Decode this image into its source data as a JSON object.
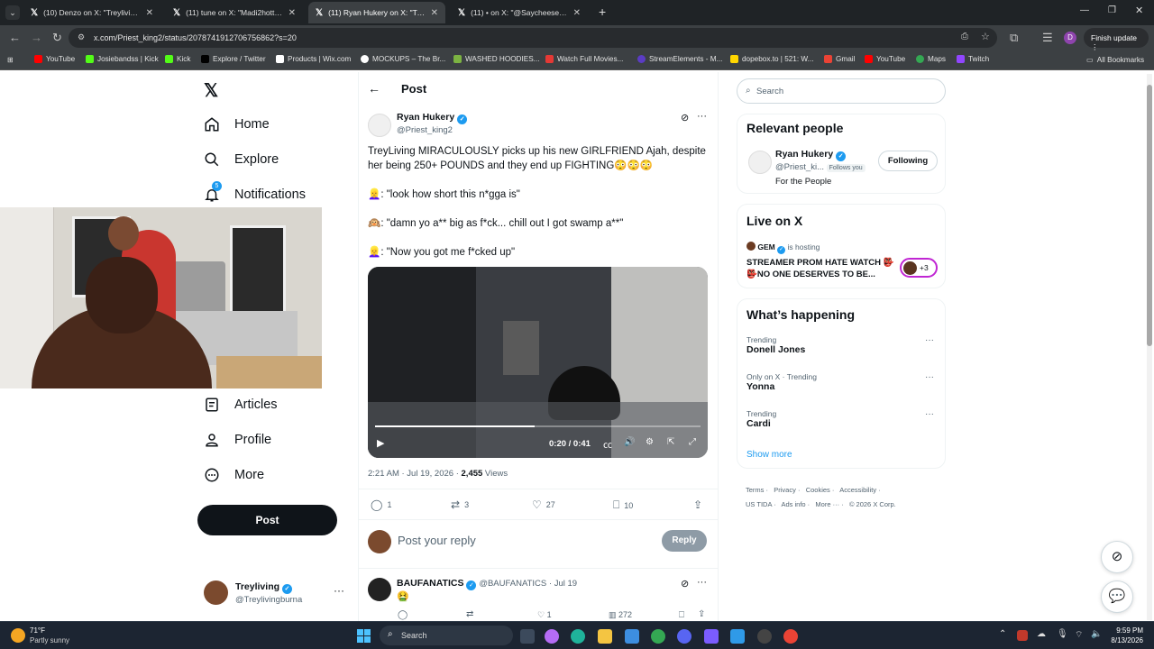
{
  "browser": {
    "tabs": [
      {
        "title": "(10) Denzo on X: \"Treyliving for",
        "active": false
      },
      {
        "title": "(11) tune on X: \"Madi2hotty sh",
        "active": false
      },
      {
        "title": "(11) Ryan Hukery on X: \"TreyLiv",
        "active": true
      },
      {
        "title": "(11) • on X: \"@SaycheeseDGTL",
        "active": false
      }
    ],
    "url": "x.com/Priest_king2/status/2078741912706756862?s=20",
    "finish_update": "Finish update",
    "profile_initial": "D",
    "bookmarks": [
      {
        "label": "YouTube",
        "color": "#ff0000"
      },
      {
        "label": "Josiebandss | Kick",
        "color": "#53fc18"
      },
      {
        "label": "Kick",
        "color": "#53fc18"
      },
      {
        "label": "Explore / Twitter",
        "color": "#000000"
      },
      {
        "label": "Products | Wix.com",
        "color": "#ffffff"
      },
      {
        "label": "MOCKUPS – The Br...",
        "color": "#ffffff"
      },
      {
        "label": "WASHED HOODIES...",
        "color": "#7cb342"
      },
      {
        "label": "Watch Full Movies...",
        "color": "#e53935"
      },
      {
        "label": "StreamElements - M...",
        "color": "#5b3cc4"
      },
      {
        "label": "dopebox.to | 521: W...",
        "color": "#ffd600"
      },
      {
        "label": "Gmail",
        "color": "#ea4335"
      },
      {
        "label": "YouTube",
        "color": "#ff0000"
      },
      {
        "label": "Maps",
        "color": "#34a853"
      },
      {
        "label": "Twitch",
        "color": "#9146ff"
      }
    ],
    "all_bookmarks": "All Bookmarks"
  },
  "sidebar": {
    "items": [
      {
        "label": "Home",
        "icon": "home-icon"
      },
      {
        "label": "Explore",
        "icon": "search-icon"
      },
      {
        "label": "Notifications",
        "icon": "bell-icon",
        "badge": "5"
      },
      {
        "label": "Articles",
        "icon": "article-icon"
      },
      {
        "label": "Profile",
        "icon": "person-icon"
      },
      {
        "label": "More",
        "icon": "more-circle-icon"
      }
    ],
    "post_button": "Post",
    "account": {
      "name": "Treyliving",
      "handle": "@Treylivingburna"
    }
  },
  "post": {
    "header": "Post",
    "author_name": "Ryan Hukery",
    "author_handle": "@Priest_king2",
    "text_main": "TreyLiving MIRACULOUSLY picks up his new GIRLFRIEND Ajah, despite her being 250+ POUNDS and they end up FIGHTING😳😳😳",
    "quote1": "👱‍♀️: \"look how short this n*gga is\"",
    "quote2": "🙉: \"damn yo a** big as f*ck... chill out I got swamp a**\"",
    "quote3": "👱‍♀️: \"Now you got me f*cked up\"",
    "video_time": "0:20 / 0:41",
    "video_progress": 0.49,
    "timestamp": "2:21 AM · Jul 19, 2026 · ",
    "views_count": "2,455",
    "views_label": " Views",
    "stats": {
      "replies": "1",
      "reposts": "3",
      "likes": "27",
      "bookmarks": "10"
    },
    "reply_placeholder": "Post your reply",
    "reply_button": "Reply"
  },
  "reply": {
    "name": "BAUFANATICS",
    "meta": "@BAUFANATICS · Jul 19",
    "text": "🤮",
    "stats": {
      "replies": "",
      "reposts": "",
      "likes": "1",
      "views": "272"
    }
  },
  "right": {
    "search_placeholder": "Search",
    "relevant_title": "Relevant people",
    "person": {
      "name": "Ryan Hukery",
      "handle": "@Priest_ki...",
      "follows_you": "Follows you",
      "bio": "For the People",
      "button": "Following"
    },
    "live_title": "Live on X",
    "live": {
      "host": "GEM",
      "hosting": "is hosting",
      "title": "STREAMER PROM HATE WATCH 👺👺NO ONE DESERVES TO BE...",
      "extra": "+3"
    },
    "happening_title": "What’s happening",
    "trends": [
      {
        "category": "Trending",
        "name": "Donell Jones"
      },
      {
        "category": "Only on X · Trending",
        "name": "Yonna"
      },
      {
        "category": "Trending",
        "name": "Cardi"
      }
    ],
    "show_more": "Show more",
    "footer_line1": [
      "Terms",
      "Privacy",
      "Cookies",
      "Accessibility"
    ],
    "footer_line2": [
      "US TIDA",
      "Ads info",
      "More ···",
      "© 2026 X Corp."
    ]
  },
  "taskbar": {
    "weather_temp": "71°F",
    "weather_desc": "Partly sunny",
    "search_placeholder": "Search",
    "time": "9:59 PM",
    "date": "8/13/2026"
  },
  "colors": {
    "accent": "#1d9bf0",
    "text": "#0f1419",
    "muted": "#536471"
  }
}
